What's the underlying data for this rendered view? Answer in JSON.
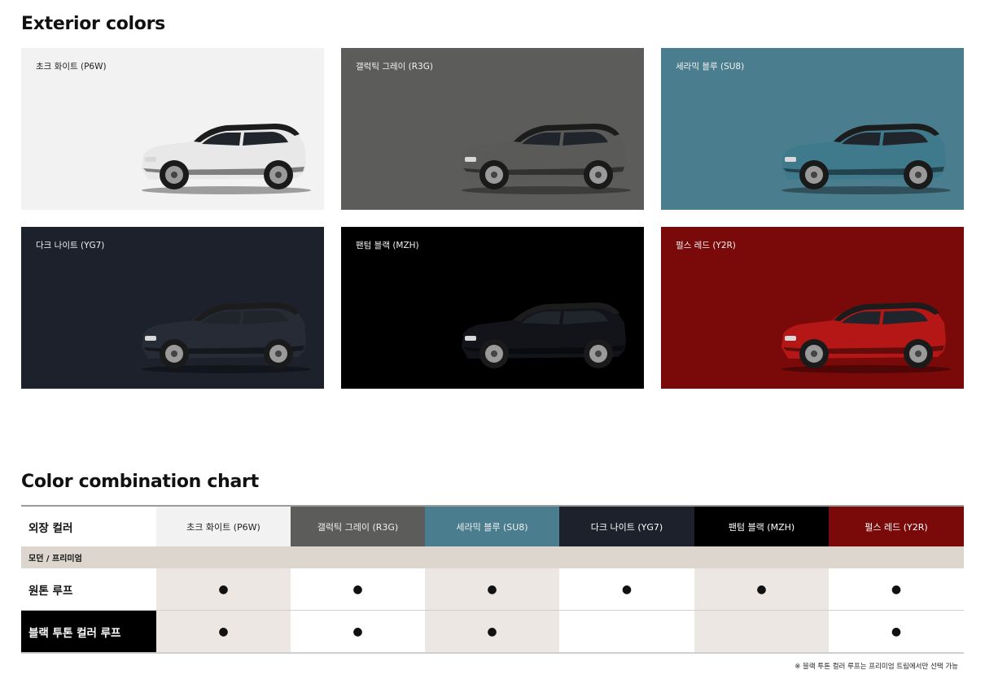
{
  "exterior": {
    "title": "Exterior colors",
    "colors": [
      {
        "label": "초크 화이트 (P6W)",
        "bg": "#f2f2f2",
        "body": "#e8e8e8",
        "roof": "#1c1c1c",
        "theme": "light"
      },
      {
        "label": "갤럭틱 그레이 (R3G)",
        "bg": "#5c5c5a",
        "body": "#5a5a58",
        "roof": "#1c1c1c",
        "theme": "dark"
      },
      {
        "label": "세라믹 블루 (SU8)",
        "bg": "#4a7d8d",
        "body": "#3f7a8c",
        "roof": "#1c1c1c",
        "theme": "dark"
      },
      {
        "label": "다크 나이트 (YG7)",
        "bg": "#1d212c",
        "body": "#262b36",
        "roof": "#1c1c1c",
        "theme": "dark"
      },
      {
        "label": "팬텀 블랙 (MZH)",
        "bg": "#000000",
        "body": "#12141a",
        "roof": "#1c1c1c",
        "theme": "dark"
      },
      {
        "label": "펄스 레드 (Y2R)",
        "bg": "#7a0a0a",
        "body": "#b51717",
        "roof": "#1c1c1c",
        "theme": "dark"
      }
    ]
  },
  "chart": {
    "title": "Color combination chart",
    "header_label": "외장 컬러",
    "columns": [
      {
        "label": "초크 화이트 (P6W)",
        "bg": "#f2f2f2",
        "fg": "#222222"
      },
      {
        "label": "갤럭틱 그레이 (R3G)",
        "bg": "#5c5c5a",
        "fg": "#f0f0f0"
      },
      {
        "label": "세라믹 블루 (SU8)",
        "bg": "#4a7d8d",
        "fg": "#f0f0f0"
      },
      {
        "label": "다크 나이트 (YG7)",
        "bg": "#1d212c",
        "fg": "#ffffff"
      },
      {
        "label": "팬텀 블랙 (MZH)",
        "bg": "#000000",
        "fg": "#ffffff"
      },
      {
        "label": "펄스 레드 (Y2R)",
        "bg": "#7a0a0a",
        "fg": "#ffffff"
      }
    ],
    "section_label": "모던 / 프리미엄",
    "rows": [
      {
        "label": "원톤 루프",
        "cells": [
          "●",
          "●",
          "●",
          "●",
          "●",
          "●"
        ],
        "style": "normal"
      },
      {
        "label": "블랙 투톤 컬러 루프",
        "cells": [
          "●",
          "●",
          "●",
          "",
          "",
          "●"
        ],
        "style": "black"
      }
    ],
    "note": "※ 블랙 투톤 컬러 루프는 프리미엄 트림에서만 선택 가능"
  }
}
